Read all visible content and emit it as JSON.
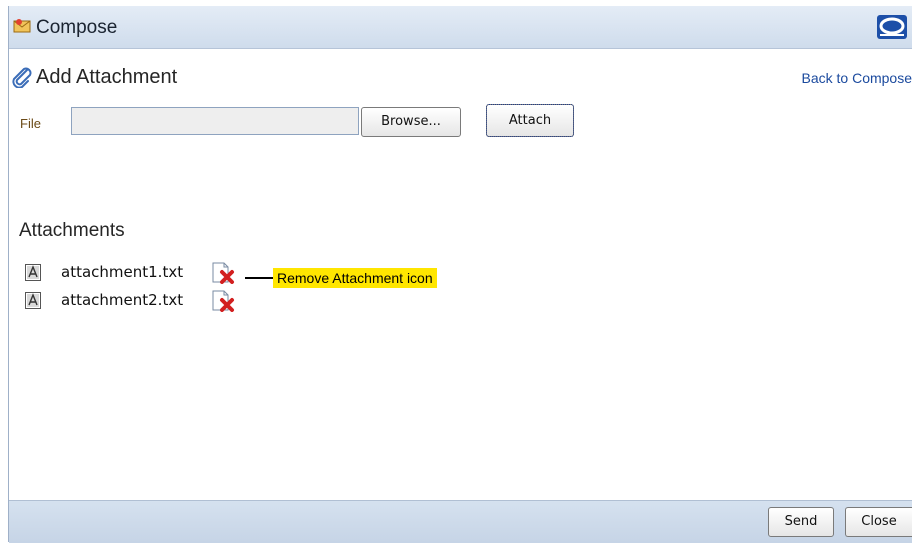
{
  "window": {
    "title": "Compose",
    "icons": {
      "title": "compose-envelope-icon",
      "logo": "oracle-logo-icon"
    }
  },
  "page": {
    "title": "Add Attachment",
    "title_icon": "paperclip-icon",
    "back_link": "Back to Compose"
  },
  "file_upload": {
    "label": "File",
    "value": "",
    "browse_label": "Browse...",
    "attach_label": "Attach"
  },
  "attachments": {
    "heading": "Attachments",
    "items": [
      {
        "name": "attachment1.txt",
        "icon": "text-file-icon",
        "remove_icon": "remove-attachment-icon"
      },
      {
        "name": "attachment2.txt",
        "icon": "text-file-icon",
        "remove_icon": "remove-attachment-icon"
      }
    ],
    "callout": "Remove Attachment icon"
  },
  "footer": {
    "send_label": "Send",
    "close_label": "Close"
  },
  "colors": {
    "titlebar": "#d8e3f1",
    "link": "#1b4a9e",
    "callout_highlight": "#ffe600",
    "file_label": "#6b4a16"
  }
}
